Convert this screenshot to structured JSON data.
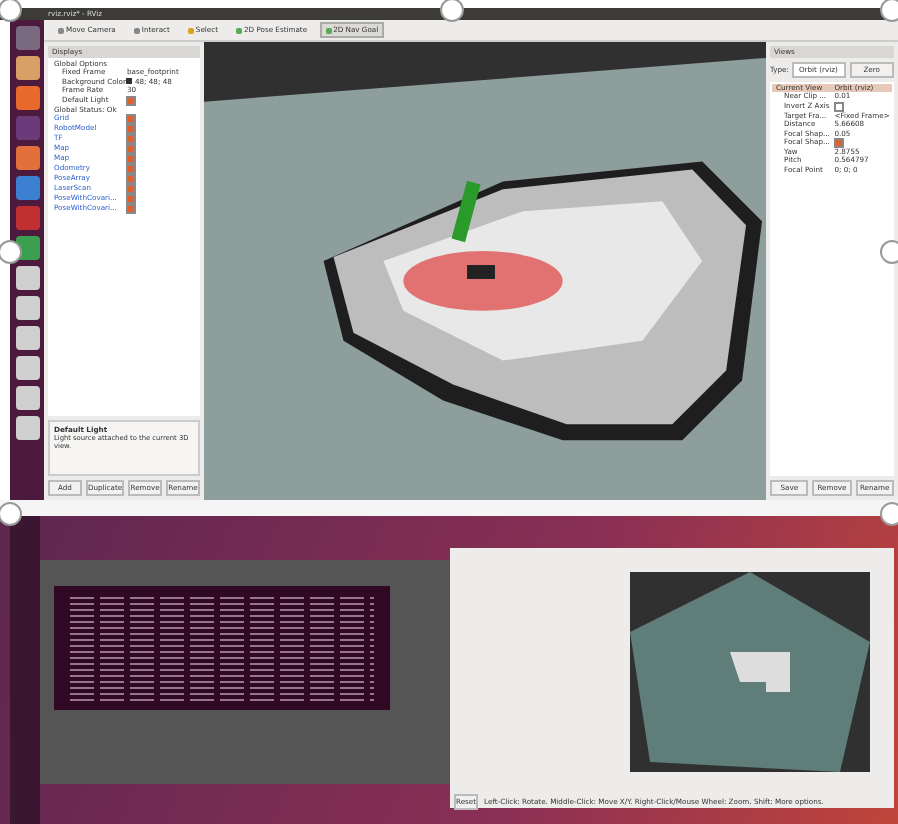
{
  "top_window": {
    "title": "rviz.rviz* - RViz",
    "toolbar": [
      {
        "label": "Move Camera",
        "selected": false
      },
      {
        "label": "Interact",
        "selected": false
      },
      {
        "label": "Select",
        "selected": false
      },
      {
        "label": "2D Pose Estimate",
        "selected": false
      },
      {
        "label": "2D Nav Goal",
        "selected": true
      }
    ],
    "displays": {
      "title": "Displays",
      "global_options": "Global Options",
      "options": [
        {
          "kind": "text",
          "name": "Fixed Frame",
          "value": "base_footprint"
        },
        {
          "kind": "color",
          "name": "Background Color",
          "value": "48; 48; 48"
        },
        {
          "kind": "text",
          "name": "Frame Rate",
          "value": "30"
        },
        {
          "kind": "check",
          "name": "Default Light",
          "checked": true
        }
      ],
      "status": "Global Status: Ok",
      "items": [
        {
          "name": "Grid",
          "checked": true
        },
        {
          "name": "RobotModel",
          "checked": true
        },
        {
          "name": "TF",
          "checked": true
        },
        {
          "name": "Map",
          "checked": true
        },
        {
          "name": "Map",
          "checked": true
        },
        {
          "name": "Odometry",
          "checked": true
        },
        {
          "name": "PoseArray",
          "checked": true
        },
        {
          "name": "LaserScan",
          "checked": true
        },
        {
          "name": "PoseWithCovari...",
          "checked": true
        },
        {
          "name": "PoseWithCovari...",
          "checked": true
        }
      ],
      "description_title": "Default Light",
      "description": "Light source attached to the current 3D view.",
      "buttons": [
        "Add",
        "Duplicate",
        "Remove",
        "Rename"
      ]
    },
    "views": {
      "title": "Views",
      "type_label": "Type:",
      "type_value": "Orbit (rviz)",
      "zero": "Zero",
      "current": "Current View",
      "current_value": "Orbit (rviz)",
      "properties": [
        {
          "kind": "text",
          "name": "Near Clip ...",
          "value": "0.01"
        },
        {
          "kind": "check",
          "name": "Invert Z Axis",
          "checked": false
        },
        {
          "kind": "text",
          "name": "Target Fra...",
          "value": "<Fixed Frame>"
        },
        {
          "kind": "text",
          "name": "Distance",
          "value": "5.66608"
        },
        {
          "kind": "text",
          "name": "Focal Shap...",
          "value": "0.05"
        },
        {
          "kind": "check",
          "name": "Focal Shap...",
          "checked": true
        },
        {
          "kind": "text",
          "name": "Yaw",
          "value": "2.8755"
        },
        {
          "kind": "text",
          "name": "Pitch",
          "value": "0.564797"
        },
        {
          "kind": "text",
          "name": "Focal Point",
          "value": "0; 0; 0"
        }
      ],
      "buttons": [
        "Save",
        "Remove",
        "Rename"
      ]
    }
  },
  "bottom_window": {
    "reset": "Reset",
    "hint": "Left-Click: Rotate. Middle-Click: Move X/Y. Right-Click/Mouse Wheel: Zoom. Shift: More options."
  }
}
